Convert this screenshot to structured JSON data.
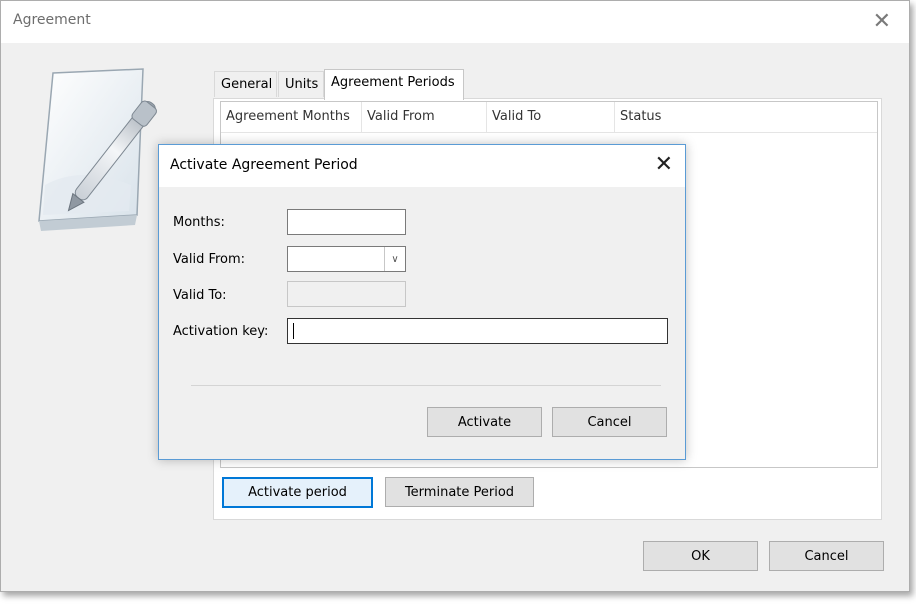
{
  "window": {
    "title": "Agreement",
    "close_glyph": "✕"
  },
  "tabs": [
    {
      "label": "General",
      "active": false
    },
    {
      "label": "Units",
      "active": false
    },
    {
      "label": "Agreement Periods",
      "active": true
    }
  ],
  "list": {
    "columns": [
      "Agreement Months",
      "Valid From",
      "Valid To",
      "Status"
    ]
  },
  "period_buttons": {
    "activate": "Activate period",
    "terminate": "Terminate Period"
  },
  "footer_buttons": {
    "ok": "OK",
    "cancel": "Cancel"
  },
  "dialog": {
    "title": "Activate Agreement Period",
    "close_glyph": "✕",
    "fields": {
      "months": {
        "label": "Months:",
        "value": ""
      },
      "valid_from": {
        "label": "Valid From:",
        "value": "",
        "dropdown_glyph": "∨"
      },
      "valid_to": {
        "label": "Valid To:",
        "value": ""
      },
      "activation_key": {
        "label": "Activation key:",
        "value": ""
      }
    },
    "buttons": {
      "activate": "Activate",
      "cancel": "Cancel"
    }
  },
  "icons": {
    "document": "document-pen-icon"
  }
}
